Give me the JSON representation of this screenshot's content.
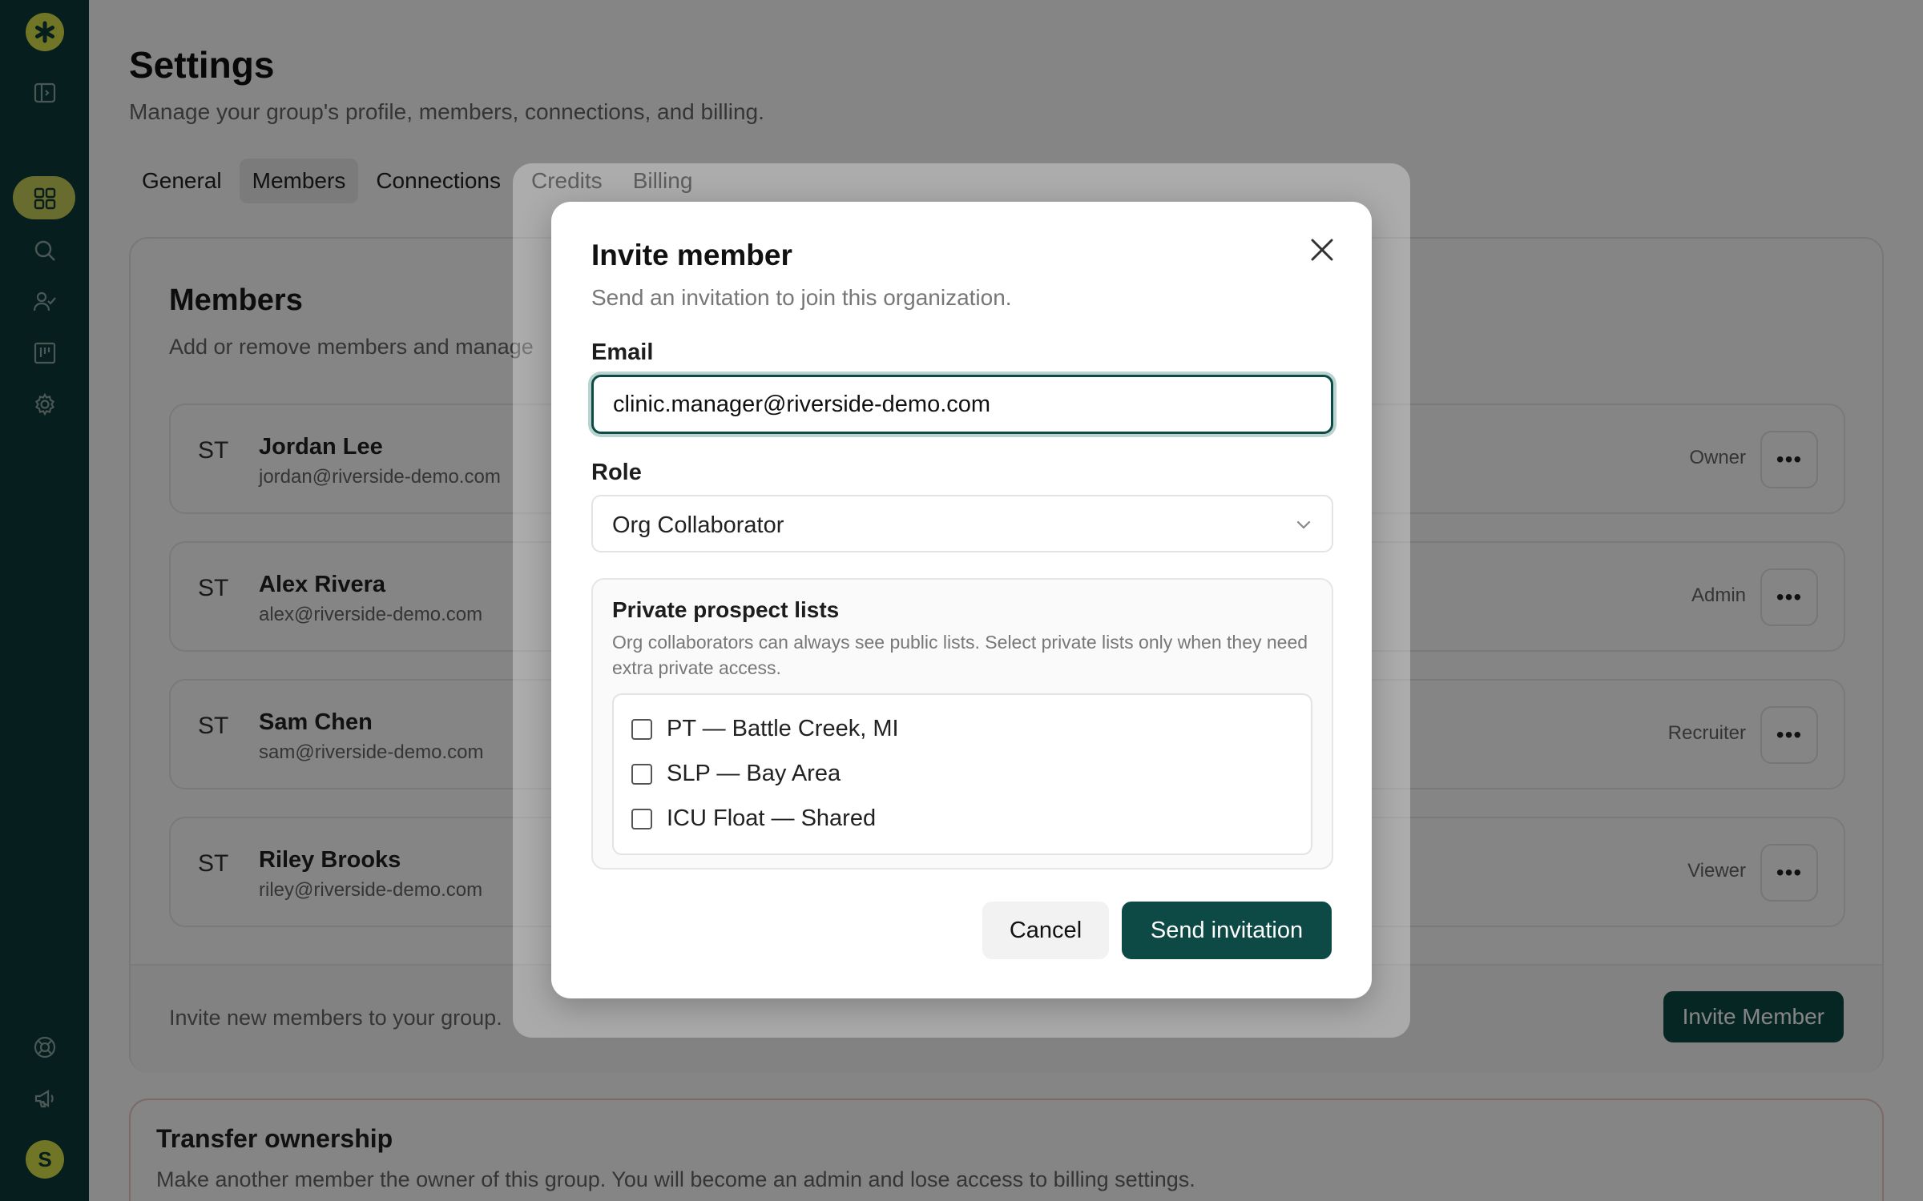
{
  "sidebar": {
    "logo_icon": "asterisk-logo-icon",
    "items": [
      {
        "icon": "sidebar-toggle-icon"
      },
      {
        "icon": "grid-icon",
        "active": true
      },
      {
        "icon": "search-icon"
      },
      {
        "icon": "user-check-icon"
      },
      {
        "icon": "board-icon"
      },
      {
        "icon": "gear-icon"
      },
      {
        "icon": "help-ring-icon"
      },
      {
        "icon": "megaphone-icon"
      }
    ],
    "avatar_initial": "S",
    "accent": "#d8e04a",
    "background": "#0d3b38"
  },
  "page": {
    "title": "Settings",
    "subtitle": "Manage your group's profile, members, connections, and billing.",
    "tabs": [
      {
        "label": "General",
        "active": false
      },
      {
        "label": "Members",
        "active": true
      },
      {
        "label": "Connections",
        "active": false
      },
      {
        "label": "Credits",
        "active": false
      },
      {
        "label": "Billing",
        "active": false
      }
    ]
  },
  "members": {
    "title": "Members",
    "subtitle": "Add or remove members and manage",
    "rows": [
      {
        "initials": "ST",
        "name": "Jordan Lee",
        "email": "jordan@riverside-demo.com",
        "role": "Owner"
      },
      {
        "initials": "ST",
        "name": "Alex Rivera",
        "email": "alex@riverside-demo.com",
        "role": "Admin"
      },
      {
        "initials": "ST",
        "name": "Sam Chen",
        "email": "sam@riverside-demo.com",
        "role": "Recruiter"
      },
      {
        "initials": "ST",
        "name": "Riley Brooks",
        "email": "riley@riverside-demo.com",
        "role": "Viewer"
      }
    ],
    "more_label": "•••",
    "footer_text": "Invite new members to your group.",
    "invite_button": "Invite Member"
  },
  "transfer": {
    "title": "Transfer ownership",
    "subtitle": "Make another member the owner of this group. You will become an admin and lose access to billing settings."
  },
  "modal": {
    "title": "Invite member",
    "subtitle": "Send an invitation to join this organization.",
    "email_label": "Email",
    "email_value": "clinic.manager@riverside-demo.com",
    "role_label": "Role",
    "role_value": "Org Collaborator",
    "lists_title": "Private prospect lists",
    "lists_desc": "Org collaborators can always see public lists. Select private lists only when they need extra private access.",
    "lists": [
      {
        "label": "PT — Battle Creek, MI",
        "checked": false
      },
      {
        "label": "SLP — Bay Area",
        "checked": false
      },
      {
        "label": "ICU Float — Shared",
        "checked": false
      }
    ],
    "cancel_label": "Cancel",
    "send_label": "Send invitation",
    "primary_color": "#0d4a45"
  }
}
